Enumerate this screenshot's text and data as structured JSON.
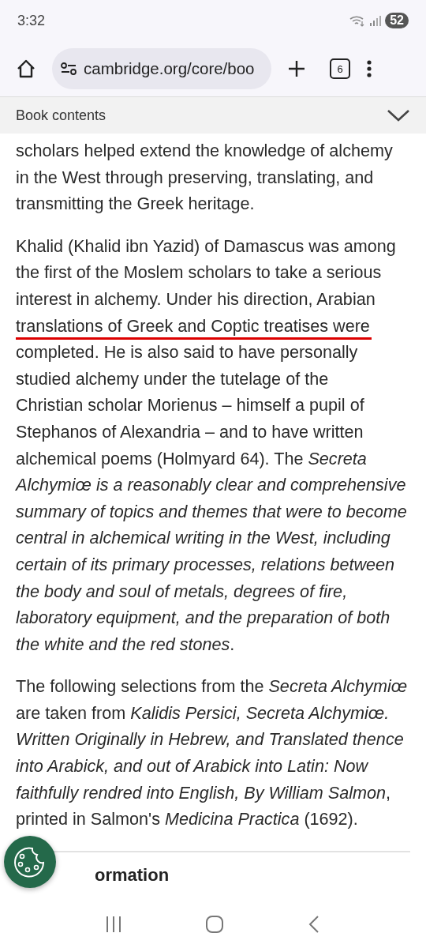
{
  "status_bar": {
    "time": "3:32",
    "battery": "52"
  },
  "browser_toolbar": {
    "url": "cambridge.org/core/boo",
    "tab_count": "6"
  },
  "book_contents_bar": {
    "label": "Book contents",
    "expanded": false
  },
  "paragraphs": [
    {
      "lines": [
        {
          "text": "scholars helped extend the knowledge of alchemy",
          "underlined": false
        },
        {
          "text": "in the West through preserving, translating, and",
          "underlined": false
        },
        {
          "text": "transmitting the Greek heritage.",
          "underlined": false
        }
      ]
    },
    {
      "lines": [
        {
          "text": "Khalid (Khalid ibn Yazid) of Damascus was among",
          "underlined": false
        },
        {
          "text": "the first of the Moslem scholars to take a serious",
          "underlined": false
        },
        {
          "text": "interest in alchemy. Under his direction, Arabian",
          "underlined": false
        },
        {
          "text": "translations of Greek and Coptic treatises were",
          "underlined": true
        },
        {
          "text": "completed. He is also said to have personally",
          "underlined": false
        },
        {
          "text": "studied alchemy under the tutelage of the",
          "underlined": false
        },
        {
          "text": "Christian scholar Morienus – himself a pupil of",
          "underlined": false
        },
        {
          "text": "Stephanos of Alexandria – and to have written",
          "underlined": false
        },
        {
          "text": "alchemical poems (Holmyard 64). The *Secreta*",
          "underlined": false
        },
        {
          "text": "*Alchymiœ is a reasonably clear and comprehensive*",
          "underlined": false
        },
        {
          "text": "*summary of topics and themes that were to become*",
          "underlined": false
        },
        {
          "text": "*central in alchemical writing in the West, including*",
          "underlined": false
        },
        {
          "text": "*certain of its primary processes, relations between*",
          "underlined": false
        },
        {
          "text": "*the body and soul of metals, degrees of fire,*",
          "underlined": false
        },
        {
          "text": "*laboratory equipment, and the preparation of both*",
          "underlined": false
        },
        {
          "text": "*the white and the red stones*.",
          "underlined": false
        }
      ]
    },
    {
      "lines": [
        {
          "text": "The following selections from the *Secreta Alchymiœ*",
          "underlined": false
        },
        {
          "text": "are taken from *Kalidis Persici, Secreta Alchymiœ.*",
          "underlined": false
        },
        {
          "text": "*Written Originally in Hebrew, and Translated thence*",
          "underlined": false
        },
        {
          "text": "*into Arabick, and out of Arabick into Latin: Now*",
          "underlined": false
        },
        {
          "text": "*faithfully rendred into English, By William Salmon*,",
          "underlined": false
        },
        {
          "text": "printed in Salmon's *Medicina Practica* (1692).",
          "underlined": false
        }
      ]
    }
  ],
  "section_heading": "ormation"
}
